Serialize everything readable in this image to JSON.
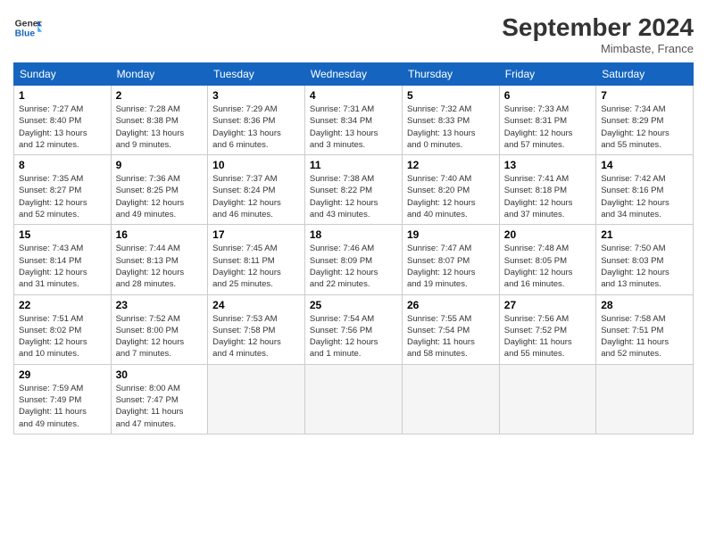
{
  "header": {
    "logo_line1": "General",
    "logo_line2": "Blue",
    "month": "September 2024",
    "location": "Mimbaste, France"
  },
  "weekdays": [
    "Sunday",
    "Monday",
    "Tuesday",
    "Wednesday",
    "Thursday",
    "Friday",
    "Saturday"
  ],
  "weeks": [
    [
      {
        "day": "1",
        "info": "Sunrise: 7:27 AM\nSunset: 8:40 PM\nDaylight: 13 hours\nand 12 minutes."
      },
      {
        "day": "2",
        "info": "Sunrise: 7:28 AM\nSunset: 8:38 PM\nDaylight: 13 hours\nand 9 minutes."
      },
      {
        "day": "3",
        "info": "Sunrise: 7:29 AM\nSunset: 8:36 PM\nDaylight: 13 hours\nand 6 minutes."
      },
      {
        "day": "4",
        "info": "Sunrise: 7:31 AM\nSunset: 8:34 PM\nDaylight: 13 hours\nand 3 minutes."
      },
      {
        "day": "5",
        "info": "Sunrise: 7:32 AM\nSunset: 8:33 PM\nDaylight: 13 hours\nand 0 minutes."
      },
      {
        "day": "6",
        "info": "Sunrise: 7:33 AM\nSunset: 8:31 PM\nDaylight: 12 hours\nand 57 minutes."
      },
      {
        "day": "7",
        "info": "Sunrise: 7:34 AM\nSunset: 8:29 PM\nDaylight: 12 hours\nand 55 minutes."
      }
    ],
    [
      {
        "day": "8",
        "info": "Sunrise: 7:35 AM\nSunset: 8:27 PM\nDaylight: 12 hours\nand 52 minutes."
      },
      {
        "day": "9",
        "info": "Sunrise: 7:36 AM\nSunset: 8:25 PM\nDaylight: 12 hours\nand 49 minutes."
      },
      {
        "day": "10",
        "info": "Sunrise: 7:37 AM\nSunset: 8:24 PM\nDaylight: 12 hours\nand 46 minutes."
      },
      {
        "day": "11",
        "info": "Sunrise: 7:38 AM\nSunset: 8:22 PM\nDaylight: 12 hours\nand 43 minutes."
      },
      {
        "day": "12",
        "info": "Sunrise: 7:40 AM\nSunset: 8:20 PM\nDaylight: 12 hours\nand 40 minutes."
      },
      {
        "day": "13",
        "info": "Sunrise: 7:41 AM\nSunset: 8:18 PM\nDaylight: 12 hours\nand 37 minutes."
      },
      {
        "day": "14",
        "info": "Sunrise: 7:42 AM\nSunset: 8:16 PM\nDaylight: 12 hours\nand 34 minutes."
      }
    ],
    [
      {
        "day": "15",
        "info": "Sunrise: 7:43 AM\nSunset: 8:14 PM\nDaylight: 12 hours\nand 31 minutes."
      },
      {
        "day": "16",
        "info": "Sunrise: 7:44 AM\nSunset: 8:13 PM\nDaylight: 12 hours\nand 28 minutes."
      },
      {
        "day": "17",
        "info": "Sunrise: 7:45 AM\nSunset: 8:11 PM\nDaylight: 12 hours\nand 25 minutes."
      },
      {
        "day": "18",
        "info": "Sunrise: 7:46 AM\nSunset: 8:09 PM\nDaylight: 12 hours\nand 22 minutes."
      },
      {
        "day": "19",
        "info": "Sunrise: 7:47 AM\nSunset: 8:07 PM\nDaylight: 12 hours\nand 19 minutes."
      },
      {
        "day": "20",
        "info": "Sunrise: 7:48 AM\nSunset: 8:05 PM\nDaylight: 12 hours\nand 16 minutes."
      },
      {
        "day": "21",
        "info": "Sunrise: 7:50 AM\nSunset: 8:03 PM\nDaylight: 12 hours\nand 13 minutes."
      }
    ],
    [
      {
        "day": "22",
        "info": "Sunrise: 7:51 AM\nSunset: 8:02 PM\nDaylight: 12 hours\nand 10 minutes."
      },
      {
        "day": "23",
        "info": "Sunrise: 7:52 AM\nSunset: 8:00 PM\nDaylight: 12 hours\nand 7 minutes."
      },
      {
        "day": "24",
        "info": "Sunrise: 7:53 AM\nSunset: 7:58 PM\nDaylight: 12 hours\nand 4 minutes."
      },
      {
        "day": "25",
        "info": "Sunrise: 7:54 AM\nSunset: 7:56 PM\nDaylight: 12 hours\nand 1 minute."
      },
      {
        "day": "26",
        "info": "Sunrise: 7:55 AM\nSunset: 7:54 PM\nDaylight: 11 hours\nand 58 minutes."
      },
      {
        "day": "27",
        "info": "Sunrise: 7:56 AM\nSunset: 7:52 PM\nDaylight: 11 hours\nand 55 minutes."
      },
      {
        "day": "28",
        "info": "Sunrise: 7:58 AM\nSunset: 7:51 PM\nDaylight: 11 hours\nand 52 minutes."
      }
    ],
    [
      {
        "day": "29",
        "info": "Sunrise: 7:59 AM\nSunset: 7:49 PM\nDaylight: 11 hours\nand 49 minutes."
      },
      {
        "day": "30",
        "info": "Sunrise: 8:00 AM\nSunset: 7:47 PM\nDaylight: 11 hours\nand 47 minutes."
      },
      {
        "day": "",
        "info": ""
      },
      {
        "day": "",
        "info": ""
      },
      {
        "day": "",
        "info": ""
      },
      {
        "day": "",
        "info": ""
      },
      {
        "day": "",
        "info": ""
      }
    ]
  ]
}
